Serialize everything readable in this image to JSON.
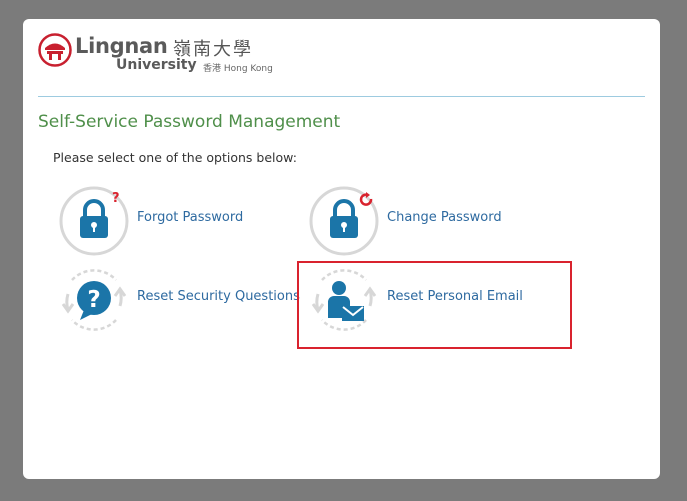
{
  "logo": {
    "name_en": "Lingnan",
    "name_cn": "嶺南大學",
    "university": "University",
    "hk": "香港 Hong Kong"
  },
  "page": {
    "title": "Self-Service Password Management",
    "instruction": "Please select one of the options below:"
  },
  "options": [
    {
      "label": "Forgot Password",
      "icon": "lock-question-icon"
    },
    {
      "label": "Change Password",
      "icon": "lock-refresh-icon"
    },
    {
      "label": "Reset Security Questions",
      "icon": "question-bubble-icon"
    },
    {
      "label": "Reset Personal Email",
      "icon": "person-email-icon"
    }
  ],
  "colors": {
    "overlay": "#7b7b7b",
    "title_green": "#4f8f4a",
    "link_blue": "#2e6aa0",
    "icon_blue": "#1b75a8",
    "accent_red": "#d9232e",
    "divider": "#9dcbe0"
  }
}
